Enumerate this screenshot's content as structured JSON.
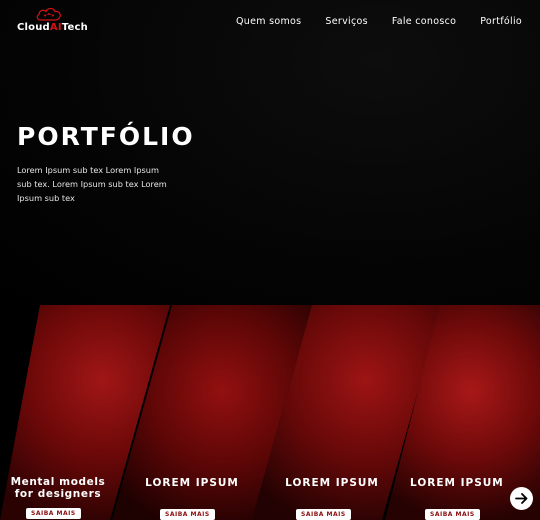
{
  "header": {
    "logo": {
      "text_main_a": "Cloud",
      "text_ai": "AI",
      "text_main_b": "Tech"
    },
    "nav": [
      "Quem somos",
      "Serviços",
      "Fale conosco",
      "Portfólio"
    ]
  },
  "hero": {
    "title": "PORTFÓLIO",
    "subtitle": "Lorem Ipsum sub tex Lorem Ipsum sub tex. Lorem Ipsum sub tex Lorem Ipsum sub tex"
  },
  "gallery": {
    "panels": [
      {
        "title_line1": "Mental models",
        "title_line2": "for designers",
        "button": "SAIBA MAIS"
      },
      {
        "title": "LOREM IPSUM",
        "button": "SAIBA MAIS"
      },
      {
        "title": "LOREM IPSUM",
        "button": "SAIBA MAIS"
      },
      {
        "title": "LOREM IPSUM",
        "button": "SAIBA MAIS"
      }
    ],
    "next_icon": "arrow-right-icon"
  },
  "colors": {
    "accent": "#d11414",
    "panel_red": "#7a0a0a",
    "background": "#000000"
  }
}
